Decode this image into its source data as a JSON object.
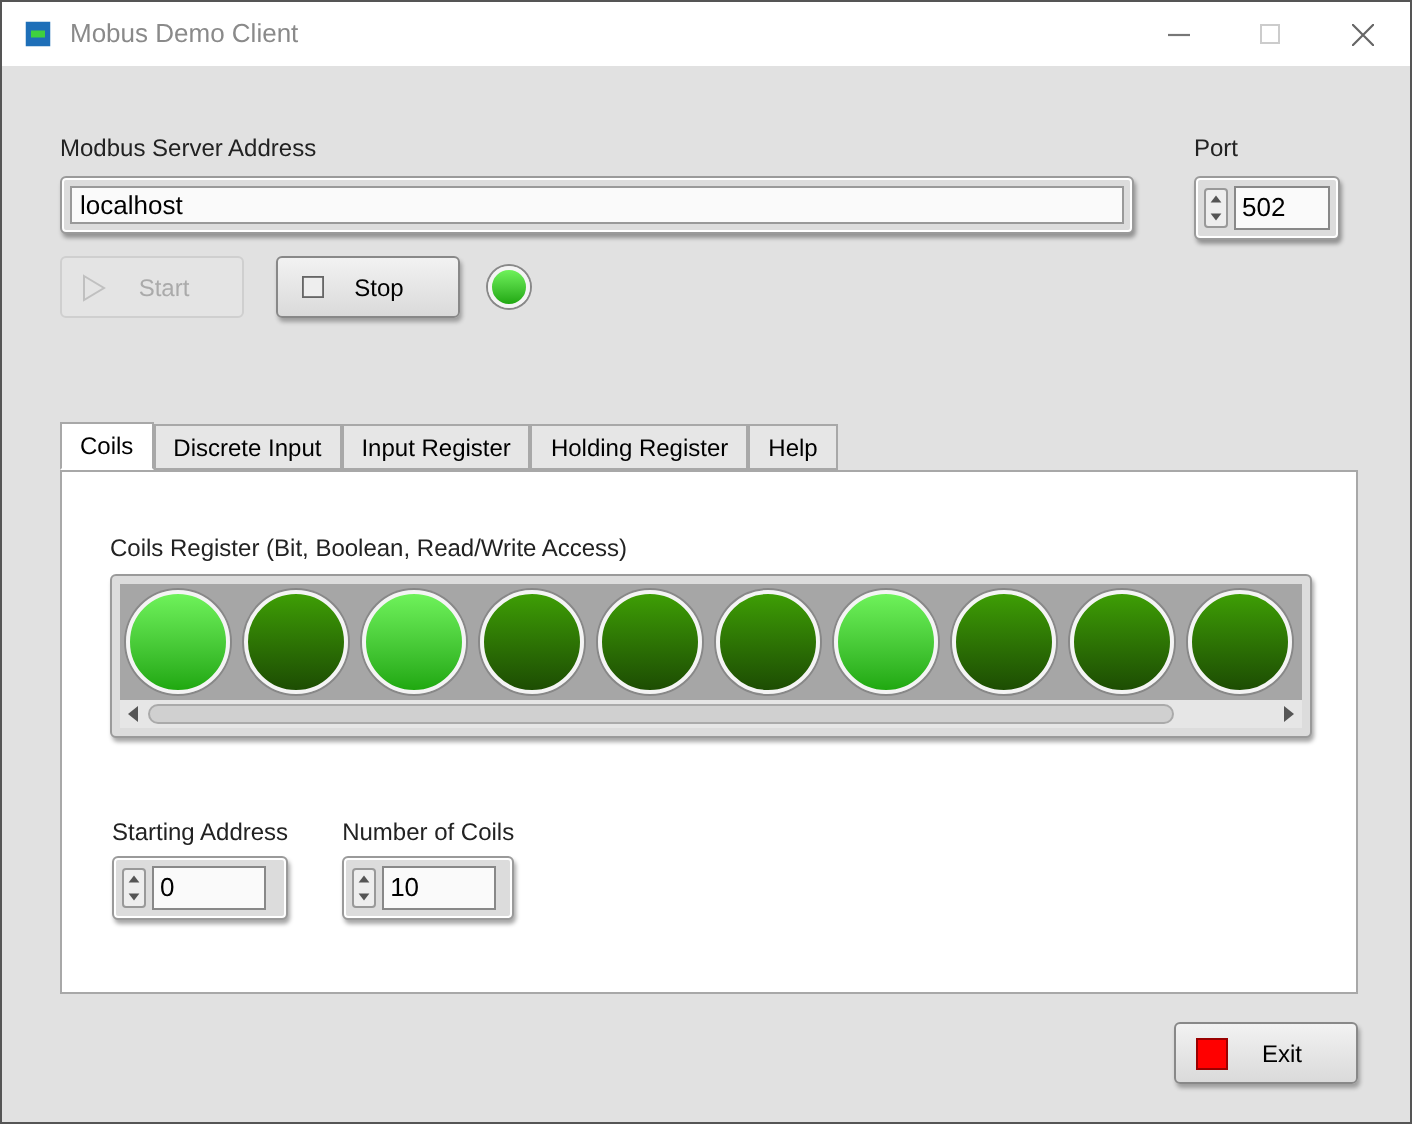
{
  "window": {
    "title": "Mobus Demo Client"
  },
  "server": {
    "label": "Modbus Server Address",
    "value": "localhost"
  },
  "port": {
    "label": "Port",
    "value": "502"
  },
  "start_button": {
    "label": "Start",
    "disabled": true
  },
  "stop_button": {
    "label": "Stop",
    "disabled": false
  },
  "connection_led": {
    "on": true
  },
  "tabs": [
    {
      "label": "Coils",
      "selected": true
    },
    {
      "label": "Discrete Input",
      "selected": false
    },
    {
      "label": "Input Register",
      "selected": false
    },
    {
      "label": "Holding Register",
      "selected": false
    },
    {
      "label": "Help",
      "selected": false
    }
  ],
  "coils": {
    "label": "Coils Register (Bit, Boolean, Read/Write Access)",
    "values": [
      {
        "on": true
      },
      {
        "on": false
      },
      {
        "on": true
      },
      {
        "on": false
      },
      {
        "on": false
      },
      {
        "on": false
      },
      {
        "on": true
      },
      {
        "on": false
      },
      {
        "on": false
      },
      {
        "on": false
      }
    ]
  },
  "starting_address": {
    "label": "Starting Address",
    "value": "0"
  },
  "number_of_coils": {
    "label": "Number of Coils",
    "value": "10"
  },
  "exit_button": {
    "label": "Exit"
  }
}
